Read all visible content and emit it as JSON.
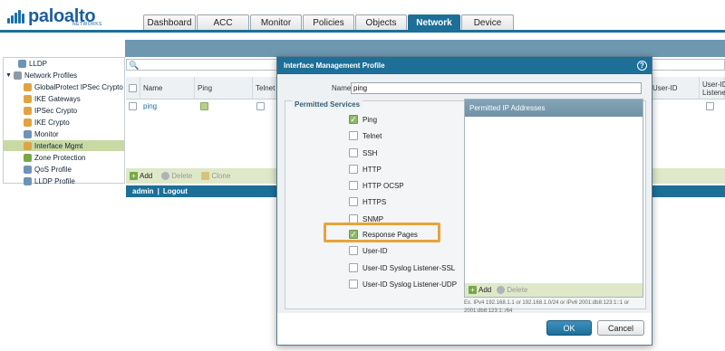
{
  "brand": {
    "name": "paloalto",
    "sub": "NETWORKS"
  },
  "tabs": [
    {
      "label": "Dashboard"
    },
    {
      "label": "ACC"
    },
    {
      "label": "Monitor"
    },
    {
      "label": "Policies"
    },
    {
      "label": "Objects"
    },
    {
      "label": "Network",
      "active": true
    },
    {
      "label": "Device"
    }
  ],
  "sidebar": {
    "items": [
      {
        "label": "LLDP"
      },
      {
        "label": "Network Profiles"
      },
      {
        "label": "GlobalProtect IPSec Crypto"
      },
      {
        "label": "IKE Gateways"
      },
      {
        "label": "IPSec Crypto"
      },
      {
        "label": "IKE Crypto"
      },
      {
        "label": "Monitor"
      },
      {
        "label": "Interface Mgmt",
        "selected": true
      },
      {
        "label": "Zone Protection"
      },
      {
        "label": "QoS Profile"
      },
      {
        "label": "LLDP Profile"
      }
    ]
  },
  "grid": {
    "headers": [
      "Name",
      "Ping",
      "Telnet",
      "User-ID",
      "User-ID Listener"
    ],
    "rows": [
      {
        "name": "ping"
      }
    ],
    "footer": {
      "add": "Add",
      "delete": "Delete",
      "clone": "Clone"
    }
  },
  "status": {
    "user": "admin",
    "separator": "|",
    "logout": "Logout"
  },
  "dialog": {
    "title": "Interface Management Profile",
    "name_label": "Name",
    "name_value": "ping",
    "permitted_services_legend": "Permitted Services",
    "services": [
      {
        "label": "Ping",
        "checked": true
      },
      {
        "label": "Telnet",
        "checked": false
      },
      {
        "label": "SSH",
        "checked": false
      },
      {
        "label": "HTTP",
        "checked": false
      },
      {
        "label": "HTTP OCSP",
        "checked": false
      },
      {
        "label": "HTTPS",
        "checked": false
      },
      {
        "label": "SNMP",
        "checked": false
      },
      {
        "label": "Response Pages",
        "checked": true
      },
      {
        "label": "User-ID",
        "checked": false
      },
      {
        "label": "User-ID Syslog Listener-SSL",
        "checked": false
      },
      {
        "label": "User-ID Syslog Listener-UDP",
        "checked": false
      }
    ],
    "ip_panel_header": "Permitted IP Addresses",
    "ip_add": "Add",
    "ip_delete": "Delete",
    "ip_hint": "Ex. IPv4 192.168.1.1 or 192.168.1.0/24 or IPv6 2001:db8:123:1::1 or 2001:db8:123:1::/64",
    "ok_label": "OK",
    "cancel_label": "Cancel"
  },
  "colors": {
    "accent": "#1d6f98",
    "selected_row": "#c9d9a4",
    "highlight_border": "#e8a33c"
  }
}
